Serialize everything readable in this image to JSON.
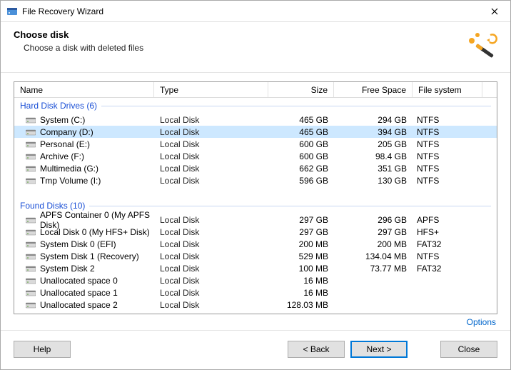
{
  "window": {
    "title": "File Recovery Wizard"
  },
  "header": {
    "title": "Choose disk",
    "subtitle": "Choose a disk with deleted files"
  },
  "columns": {
    "name": "Name",
    "type": "Type",
    "size": "Size",
    "free": "Free Space",
    "fs": "File system"
  },
  "groups": [
    {
      "label": "Hard Disk Drives (6)",
      "items": [
        {
          "name": "System (C:)",
          "type": "Local Disk",
          "size": "465 GB",
          "free": "294 GB",
          "fs": "NTFS",
          "selected": false
        },
        {
          "name": "Company (D:)",
          "type": "Local Disk",
          "size": "465 GB",
          "free": "394 GB",
          "fs": "NTFS",
          "selected": true
        },
        {
          "name": "Personal (E:)",
          "type": "Local Disk",
          "size": "600 GB",
          "free": "205 GB",
          "fs": "NTFS",
          "selected": false
        },
        {
          "name": "Archive (F:)",
          "type": "Local Disk",
          "size": "600 GB",
          "free": "98.4 GB",
          "fs": "NTFS",
          "selected": false
        },
        {
          "name": "Multimedia (G:)",
          "type": "Local Disk",
          "size": "662 GB",
          "free": "351 GB",
          "fs": "NTFS",
          "selected": false
        },
        {
          "name": "Tmp Volume (I:)",
          "type": "Local Disk",
          "size": "596 GB",
          "free": "130 GB",
          "fs": "NTFS",
          "selected": false
        }
      ]
    },
    {
      "label": "Found Disks (10)",
      "items": [
        {
          "name": "APFS Container 0 (My APFS Disk)",
          "type": "Local Disk",
          "size": "297 GB",
          "free": "296 GB",
          "fs": "APFS",
          "selected": false
        },
        {
          "name": "Local Disk 0 (My HFS+ Disk)",
          "type": "Local Disk",
          "size": "297 GB",
          "free": "297 GB",
          "fs": "HFS+",
          "selected": false
        },
        {
          "name": "System Disk 0 (EFI)",
          "type": "Local Disk",
          "size": "200 MB",
          "free": "200 MB",
          "fs": "FAT32",
          "selected": false
        },
        {
          "name": "System Disk 1 (Recovery)",
          "type": "Local Disk",
          "size": "529 MB",
          "free": "134.04 MB",
          "fs": "NTFS",
          "selected": false
        },
        {
          "name": "System Disk 2",
          "type": "Local Disk",
          "size": "100 MB",
          "free": "73.77 MB",
          "fs": "FAT32",
          "selected": false
        },
        {
          "name": "Unallocated space 0",
          "type": "Local Disk",
          "size": "16 MB",
          "free": "",
          "fs": "",
          "selected": false
        },
        {
          "name": "Unallocated space 1",
          "type": "Local Disk",
          "size": "16 MB",
          "free": "",
          "fs": "",
          "selected": false
        },
        {
          "name": "Unallocated space 2",
          "type": "Local Disk",
          "size": "128.03 MB",
          "free": "",
          "fs": "",
          "selected": false
        }
      ]
    }
  ],
  "links": {
    "options": "Options"
  },
  "buttons": {
    "help": "Help",
    "back": "< Back",
    "next": "Next >",
    "close": "Close"
  }
}
